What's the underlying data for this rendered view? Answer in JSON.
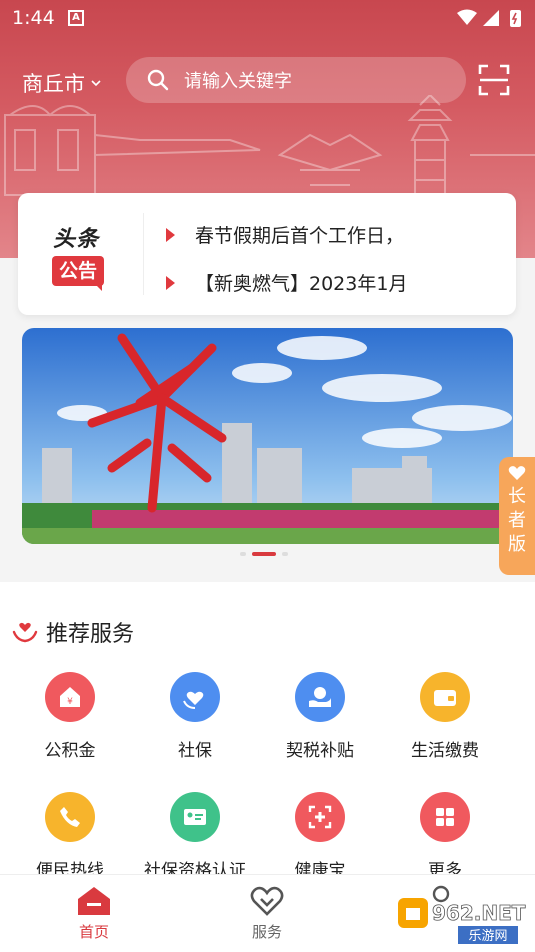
{
  "status_bar": {
    "time": "1:44",
    "notif_badge": "A"
  },
  "header": {
    "city": "商丘市",
    "search_placeholder": "请输入关键字"
  },
  "notice": {
    "logo_top": "头条",
    "logo_bottom": "公告",
    "items": [
      "春节假期后首个工作日，",
      "【新奥燃气】2023年1月"
    ]
  },
  "banner": {
    "carousel_index": 2,
    "carousel_count": 3
  },
  "elder_mode": {
    "chars": [
      "长",
      "者",
      "版"
    ]
  },
  "services": {
    "title": "推荐服务",
    "items": [
      {
        "label": "公积金",
        "color": "#f0595e",
        "icon": "house-yen-icon"
      },
      {
        "label": "社保",
        "color": "#4e8ef0",
        "icon": "shield-heart-icon"
      },
      {
        "label": "契税补贴",
        "color": "#4e8ef0",
        "icon": "hand-coin-icon"
      },
      {
        "label": "生活缴费",
        "color": "#f7b42c",
        "icon": "wallet-icon"
      },
      {
        "label": "便民热线",
        "color": "#f7b42c",
        "icon": "phone-icon"
      },
      {
        "label": "社保资格认证",
        "color": "#3fc28a",
        "icon": "id-card-icon"
      },
      {
        "label": "健康宝",
        "color": "#f0595e",
        "icon": "health-scan-icon"
      },
      {
        "label": "更多",
        "color": "#f0595e",
        "icon": "grid-icon"
      }
    ]
  },
  "tabbar": {
    "tabs": [
      "首页",
      "服务"
    ]
  },
  "watermark": {
    "text": "962.NET",
    "sub": "乐游网"
  },
  "colors": {
    "brand_red": "#d93a3f",
    "elder_orange": "#f7a65a"
  }
}
